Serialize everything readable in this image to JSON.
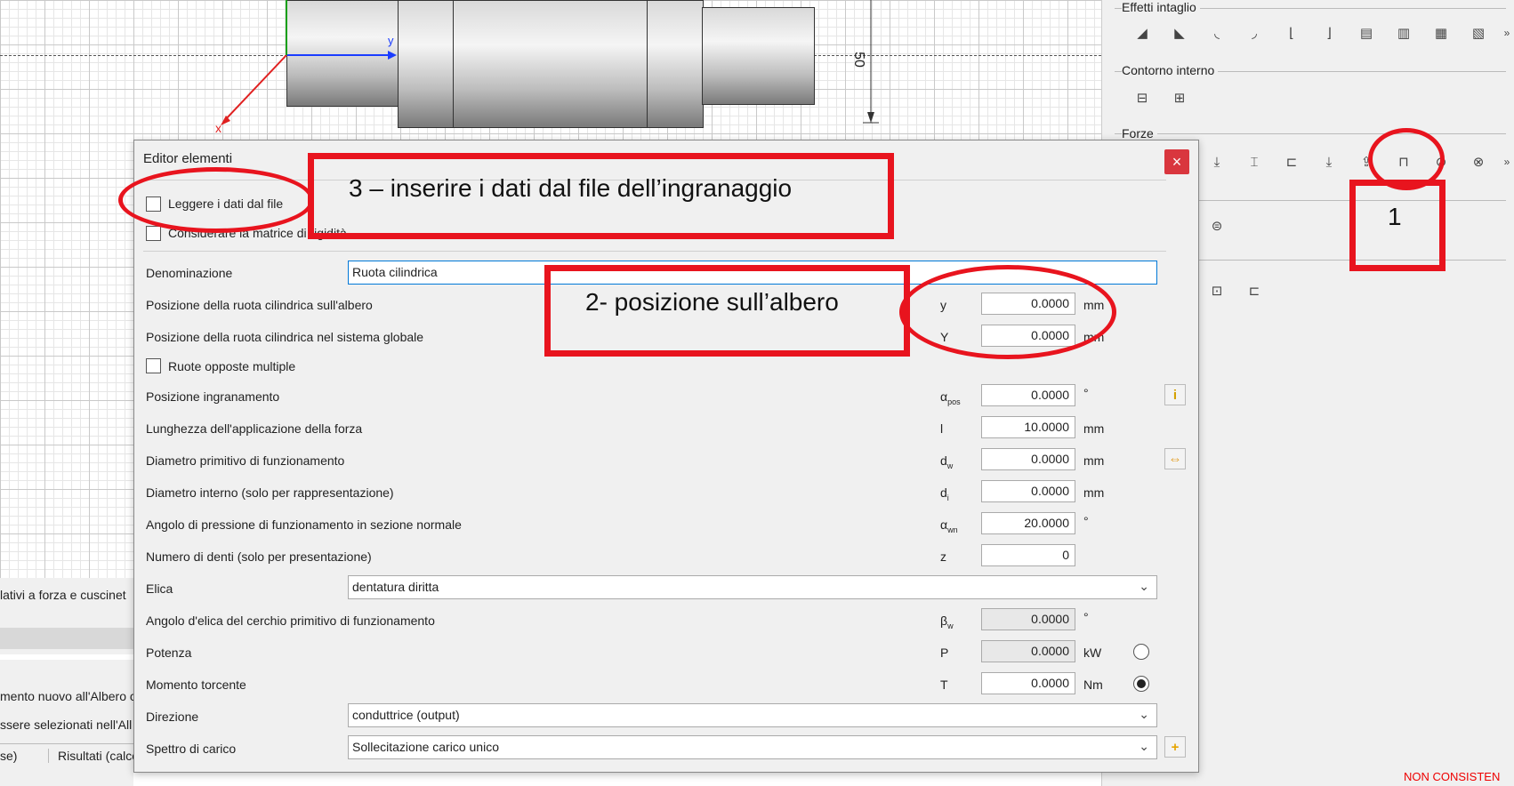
{
  "canvas": {
    "axis_y_label": "y",
    "axis_x_label": "x",
    "dimension_label": "50"
  },
  "background": {
    "left_text_1": "lativi a forza e cuscinet",
    "left_text_2": "mento nuovo all'Albero c",
    "left_text_3": "ssere selezionati nell'All",
    "tab_1": "se)",
    "tab_2": "Risultati (calco"
  },
  "right_panel": {
    "section_effetti": "Effetti intaglio",
    "section_contorno": "Contorno interno",
    "section_forze": "Forze",
    "status": "NON CONSISTEN"
  },
  "dialog": {
    "title": "Editor elementi",
    "close": "×",
    "checkbox_read_file": "Leggere i dati dal file",
    "checkbox_stiffness": "Considerare la matrice di rigidità",
    "rows": {
      "denominazione": {
        "label": "Denominazione",
        "value": "Ruota cilindrica"
      },
      "pos_albero": {
        "label": "Posizione della ruota cilindrica sull'albero",
        "symbol": "y",
        "value": "0.0000",
        "unit": "mm"
      },
      "pos_globale": {
        "label": "Posizione della ruota cilindrica nel sistema globale",
        "symbol": "Y",
        "value": "0.0000",
        "unit": "mm"
      },
      "ruote_opposte": {
        "label": "Ruote opposte multiple"
      },
      "pos_ingran": {
        "label": "Posizione ingranamento",
        "symbol": "α",
        "symbol_sub": "pos",
        "value": "0.0000",
        "unit": "°"
      },
      "lunghezza": {
        "label": "Lunghezza dell'applicazione della forza",
        "symbol": "l",
        "value": "10.0000",
        "unit": "mm"
      },
      "diam_prim": {
        "label": "Diametro primitivo di funzionamento",
        "symbol": "d",
        "symbol_sub": "w",
        "value": "0.0000",
        "unit": "mm"
      },
      "diam_int": {
        "label": "Diametro interno (solo per rappresentazione)",
        "symbol": "d",
        "symbol_sub": "i",
        "value": "0.0000",
        "unit": "mm"
      },
      "angolo_press": {
        "label": "Angolo di pressione di funzionamento in sezione normale",
        "symbol": "α",
        "symbol_sub": "wn",
        "value": "20.0000",
        "unit": "°"
      },
      "num_denti": {
        "label": "Numero di denti (solo per presentazione)",
        "symbol": "z",
        "value": "0"
      },
      "elica": {
        "label": "Elica",
        "value": "dentatura diritta"
      },
      "angolo_elica": {
        "label": "Angolo d'elica del cerchio primitivo di funzionamento",
        "symbol": "β",
        "symbol_sub": "w",
        "value": "0.0000",
        "unit": "°"
      },
      "potenza": {
        "label": "Potenza",
        "symbol": "P",
        "value": "0.0000",
        "unit": "kW"
      },
      "momento": {
        "label": "Momento torcente",
        "symbol": "T",
        "value": "0.0000",
        "unit": "Nm"
      },
      "direzione": {
        "label": "Direzione",
        "value": "conduttrice (output)"
      },
      "spettro": {
        "label": "Spettro di carico",
        "value": "Sollecitazione carico unico"
      }
    }
  },
  "annotations": {
    "a1": "1",
    "a2": "2- posizione sull’albero",
    "a3": "3 – inserire i dati dal file dell’ingranaggio"
  }
}
